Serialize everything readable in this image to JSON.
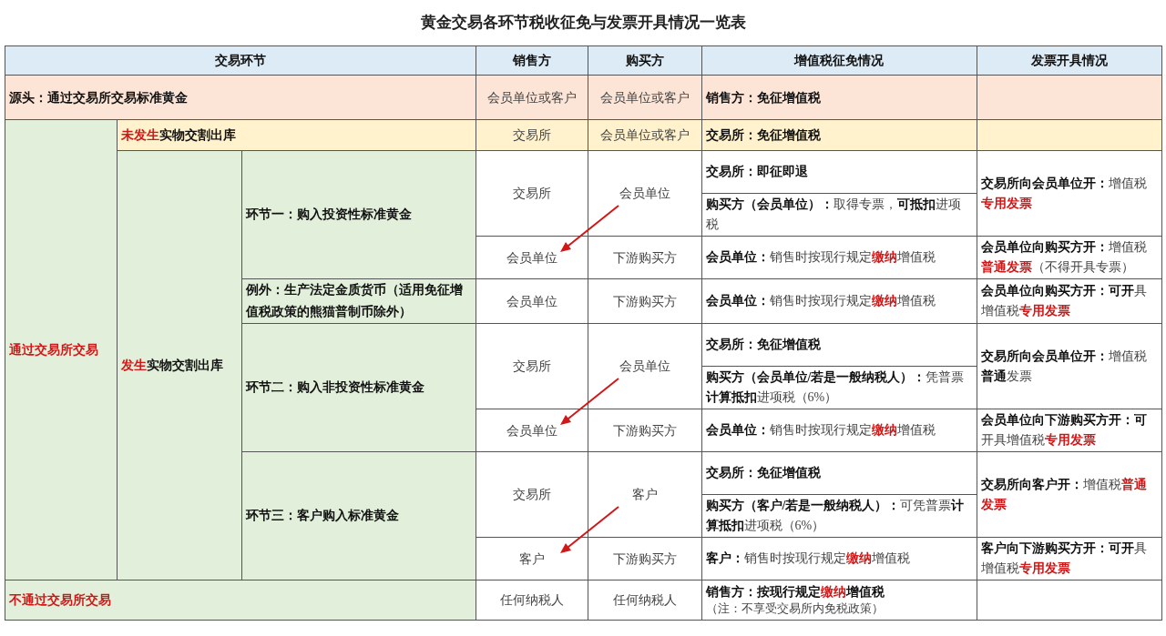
{
  "title": "黄金交易各环节税收征免与发票开具情况一览表",
  "header": [
    "交易环节",
    "销售方",
    "购买方",
    "增值税征免情况",
    "发票开具情况"
  ],
  "source": {
    "stage": [
      {
        "t": "源头：通过交易所交易标准黄金",
        "kind": "bold"
      }
    ],
    "seller": "会员单位或客户",
    "buyer": "会员单位或客户",
    "vat": [
      {
        "t": "销售方：免征增值税",
        "kind": "bold"
      }
    ]
  },
  "exchange": {
    "label": [
      {
        "t": "通过交易所交易",
        "kind": "red"
      }
    ],
    "no_delivery": {
      "stage": [
        {
          "t": "未发生",
          "kind": "red"
        },
        {
          "t": "实物交割出库",
          "kind": "bold"
        }
      ],
      "seller": "交易所",
      "buyer": "会员单位或客户",
      "vat": [
        {
          "t": "交易所：免征增值税",
          "kind": "bold"
        }
      ]
    },
    "delivery": {
      "label": [
        {
          "t": "发生",
          "kind": "red"
        },
        {
          "t": "实物交割出库",
          "kind": "bold"
        }
      ],
      "steps": [
        {
          "name": "环节一：购入投资性标准黄金",
          "legs": [
            {
              "seller": "交易所",
              "buyer": "会员单位",
              "arrow": false,
              "vat": [
                [
                  {
                    "t": "交易所：即征即退",
                    "kind": "bold"
                  }
                ],
                [
                  {
                    "t": "购买方（会员单位）：",
                    "kind": "bold"
                  },
                  {
                    "t": "取得专票，",
                    "kind": "plain"
                  },
                  {
                    "t": "可抵扣",
                    "kind": "bold"
                  },
                  {
                    "t": "进项税",
                    "kind": "plain"
                  }
                ]
              ],
              "invoice": [
                {
                  "t": "交易所向会员单位开：",
                  "kind": "bold"
                },
                {
                  "t": "增值税",
                  "kind": "plain"
                },
                {
                  "t": "专用发票",
                  "kind": "red"
                }
              ]
            },
            {
              "seller": "会员单位",
              "buyer": "下游购买方",
              "arrow": true,
              "vat": [
                [
                  {
                    "t": "会员单位：",
                    "kind": "bold"
                  },
                  {
                    "t": "销售时按现行规定",
                    "kind": "plain"
                  },
                  {
                    "t": "缴纳",
                    "kind": "red"
                  },
                  {
                    "t": "增值税",
                    "kind": "plain"
                  }
                ]
              ],
              "invoice": [
                {
                  "t": "会员单位向购买方开：",
                  "kind": "bold"
                },
                {
                  "t": "增值税",
                  "kind": "plain"
                },
                {
                  "t": "普通发票",
                  "kind": "red"
                },
                {
                  "t": "（不得开具专票）",
                  "kind": "plain"
                }
              ]
            }
          ]
        },
        {
          "name": "例外：生产法定金质货币（适用免征增值税政策的熊猫普制币除外）",
          "legs": [
            {
              "seller": "会员单位",
              "buyer": "下游购买方",
              "arrow": false,
              "vat": [
                [
                  {
                    "t": "会员单位：",
                    "kind": "bold"
                  },
                  {
                    "t": "销售时按现行规定",
                    "kind": "plain"
                  },
                  {
                    "t": "缴纳",
                    "kind": "red"
                  },
                  {
                    "t": "增值税",
                    "kind": "plain"
                  }
                ]
              ],
              "invoice": [
                {
                  "t": "会员单位向购买方开：可开",
                  "kind": "bold"
                },
                {
                  "t": "具增值税",
                  "kind": "plain"
                },
                {
                  "t": "专用发票",
                  "kind": "red"
                }
              ]
            }
          ]
        },
        {
          "name": "环节二：购入非投资性标准黄金",
          "legs": [
            {
              "seller": "交易所",
              "buyer": "会员单位",
              "arrow": false,
              "vat": [
                [
                  {
                    "t": "交易所：免征增值税",
                    "kind": "bold"
                  }
                ],
                [
                  {
                    "t": "购买方（会员单位/若是一般纳税人）：",
                    "kind": "bold"
                  },
                  {
                    "t": "凭普票",
                    "kind": "plain"
                  },
                  {
                    "t": "计算抵扣",
                    "kind": "bold"
                  },
                  {
                    "t": "进项税（6%）",
                    "kind": "plain"
                  }
                ]
              ],
              "invoice": [
                {
                  "t": "交易所向会员单位开：",
                  "kind": "bold"
                },
                {
                  "t": "增值税",
                  "kind": "plain"
                },
                {
                  "t": "普通",
                  "kind": "bold"
                },
                {
                  "t": "发票",
                  "kind": "plain"
                }
              ]
            },
            {
              "seller": "会员单位",
              "buyer": "下游购买方",
              "arrow": true,
              "vat": [
                [
                  {
                    "t": "会员单位：",
                    "kind": "bold"
                  },
                  {
                    "t": "销售时按现行规定",
                    "kind": "plain"
                  },
                  {
                    "t": "缴纳",
                    "kind": "red"
                  },
                  {
                    "t": "增值税",
                    "kind": "plain"
                  }
                ]
              ],
              "invoice": [
                {
                  "t": "会员单位向下游购买方开：可",
                  "kind": "bold"
                },
                {
                  "t": "开具增值税",
                  "kind": "plain"
                },
                {
                  "t": "专用发票",
                  "kind": "red"
                }
              ]
            }
          ]
        },
        {
          "name": "环节三：客户购入标准黄金",
          "legs": [
            {
              "seller": "交易所",
              "buyer": "客户",
              "arrow": false,
              "vat": [
                [
                  {
                    "t": "交易所：免征增值税",
                    "kind": "bold"
                  }
                ],
                [
                  {
                    "t": "购买方（客户/若是一般纳税人）：",
                    "kind": "bold"
                  },
                  {
                    "t": "可凭普票",
                    "kind": "plain"
                  },
                  {
                    "t": "计算抵扣",
                    "kind": "bold"
                  },
                  {
                    "t": "进项税（6%）",
                    "kind": "plain"
                  }
                ]
              ],
              "invoice": [
                {
                  "t": "交易所向客户开：",
                  "kind": "bold"
                },
                {
                  "t": "增值税",
                  "kind": "plain"
                },
                {
                  "t": "普通发票",
                  "kind": "red"
                }
              ]
            },
            {
              "seller": "客户",
              "buyer": "下游购买方",
              "arrow": true,
              "vat": [
                [
                  {
                    "t": "客户：",
                    "kind": "bold"
                  },
                  {
                    "t": "销售时按现行规定",
                    "kind": "plain"
                  },
                  {
                    "t": "缴纳",
                    "kind": "red"
                  },
                  {
                    "t": "增值税",
                    "kind": "plain"
                  }
                ]
              ],
              "invoice": [
                {
                  "t": "客户向下游购买方开：可开",
                  "kind": "bold"
                },
                {
                  "t": "具增值税",
                  "kind": "plain"
                },
                {
                  "t": "专用发票",
                  "kind": "red"
                }
              ]
            }
          ]
        }
      ]
    }
  },
  "off_exchange": {
    "label": [
      {
        "t": "不通过交易所交易",
        "kind": "red"
      }
    ],
    "seller": "任何纳税人",
    "buyer": "任何纳税人",
    "vat": [
      {
        "t": "销售方：按现行规定",
        "kind": "bold"
      },
      {
        "t": "缴纳",
        "kind": "red"
      },
      {
        "t": "增值税",
        "kind": "bold"
      }
    ],
    "note": "（注：不享受交易所内免税政策）"
  }
}
